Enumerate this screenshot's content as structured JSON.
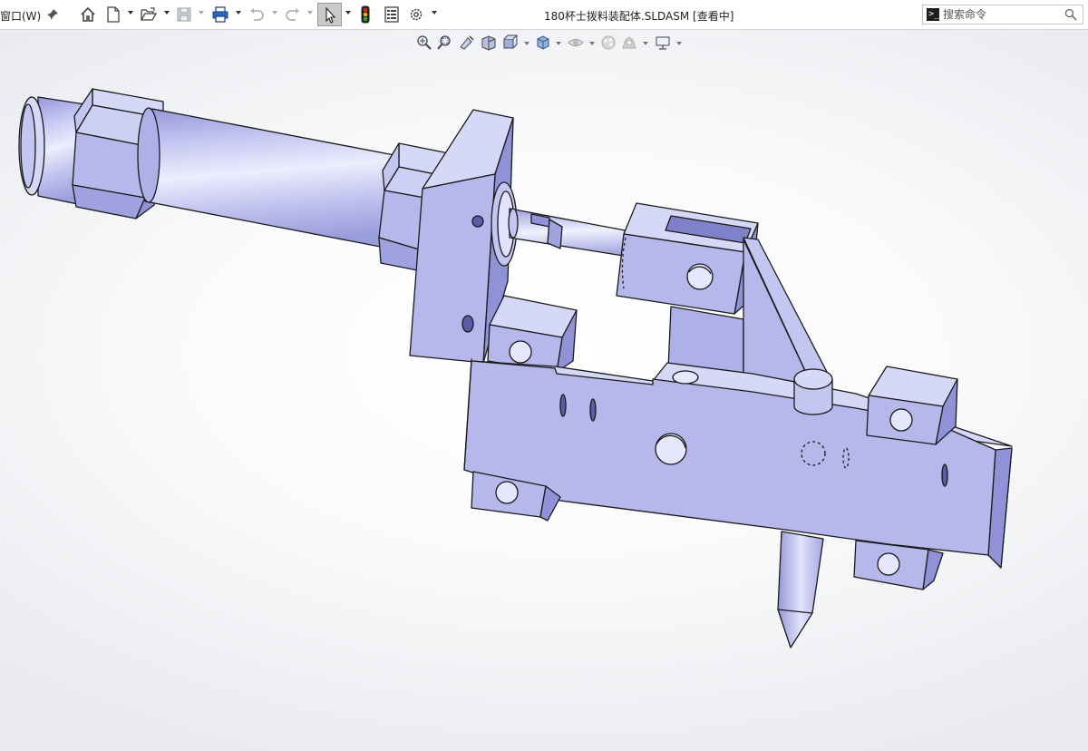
{
  "menu": {
    "window_label": "窗口(W)"
  },
  "toolbar": {
    "items": [
      "pin-icon",
      "home-icon",
      "new-document-icon",
      "open-icon",
      "save-icon",
      "print-icon",
      "undo-icon",
      "redo-icon",
      "select-icon",
      "rebuild-icon",
      "file-properties-icon",
      "options-icon"
    ]
  },
  "document": {
    "title": "180杯士拨料装配体.SLDASM [查看中]"
  },
  "search": {
    "placeholder": "搜索命令",
    "value": ""
  },
  "view_toolbar": {
    "items": [
      "zoom-to-fit-icon",
      "zoom-to-area-icon",
      "previous-view-icon",
      "section-view-icon",
      "view-orientation-icon",
      "display-style-icon",
      "hide-show-items-icon",
      "edit-appearance-icon",
      "apply-scene-icon",
      "view-settings-icon"
    ]
  },
  "colors": {
    "part_face": "#b6b8ec",
    "part_face_light": "#d6d8f7",
    "part_face_dark": "#8f92d6",
    "edge": "#1a1a1a",
    "selected_tool": "#c9c9c9",
    "rebuild_red": "#e0202a"
  }
}
